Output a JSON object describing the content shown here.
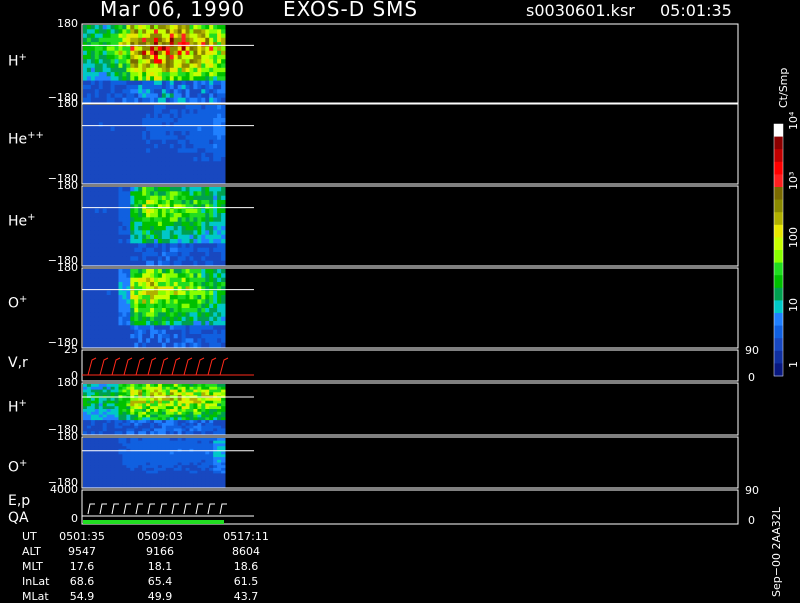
{
  "header": {
    "date": "Mar 06, 1990",
    "instrument": "EXOS-D SMS",
    "file": "s0030601.ksr",
    "time": "05:01:35"
  },
  "colors": {
    "background": "#000000",
    "frame": "#ffffff",
    "velocity_trace": "#ff2a1a",
    "qa_bar": "#22dd22"
  },
  "panels": [
    {
      "id": "h-plus",
      "label": "H",
      "sup": "+",
      "top": "180",
      "bottom": "−180"
    },
    {
      "id": "he-plus-plus",
      "label": "He",
      "sup": "++",
      "top": "180",
      "bottom": "−180"
    },
    {
      "id": "he-plus",
      "label": "He",
      "sup": "+",
      "top": "180",
      "bottom": "−180"
    },
    {
      "id": "o-plus",
      "label": "O",
      "sup": "+",
      "top": "180",
      "bottom": "−180"
    },
    {
      "id": "v-r",
      "label": "V,r",
      "sup": "",
      "top": "25",
      "bottom": "0",
      "right_top": "90",
      "right_bottom": "0"
    },
    {
      "id": "h-plus-2",
      "label": "H",
      "sup": "+",
      "top": "180",
      "bottom": "−180"
    },
    {
      "id": "o-plus-2",
      "label": "O",
      "sup": "+",
      "top": "180",
      "bottom": "−180"
    },
    {
      "id": "e-p",
      "label": "E,p",
      "sup": "",
      "top": "4000",
      "bottom": "0",
      "right_top": "90",
      "right_bottom": "0"
    }
  ],
  "qa_label": "QA",
  "colorbar": {
    "unit": "Ct/Smp",
    "labels": [
      "10⁴",
      "10³",
      "100",
      "10",
      "1"
    ],
    "stops": [
      "#ffffff",
      "#8b0000",
      "#c00000",
      "#ff0000",
      "#ff2020",
      "#7a6a00",
      "#8a8a00",
      "#b0b000",
      "#e8e800",
      "#c8ff00",
      "#88ff00",
      "#20dd20",
      "#00c000",
      "#00a050",
      "#00c8c8",
      "#2080ff",
      "#1060e0",
      "#1848c0",
      "#1030a0",
      "#081880"
    ]
  },
  "side_label": "Sep−00  2AA32L",
  "footer": {
    "rows": [
      {
        "name": "UT",
        "values": [
          "0501:35",
          "0509:03",
          "0517:11"
        ]
      },
      {
        "name": "ALT",
        "values": [
          "9547",
          "9166",
          "8604"
        ]
      },
      {
        "name": "MLT",
        "values": [
          "17.6",
          "18.1",
          "18.6"
        ]
      },
      {
        "name": "InLat",
        "values": [
          "68.6",
          "65.4",
          "61.5"
        ]
      },
      {
        "name": "MLat",
        "values": [
          "54.9",
          "49.9",
          "43.7"
        ]
      }
    ]
  },
  "chart_data": {
    "type": "heatmap",
    "x_ticks": [
      "0501:35",
      "0509:03",
      "0517:11"
    ],
    "y_range_pitch": [
      -180,
      180
    ],
    "colorbar_range": [
      1,
      10000
    ],
    "colorbar_scale": "log",
    "panels": [
      {
        "name": "H+",
        "activity": [
          0.35,
          0.35,
          0.4,
          0.55,
          0.8,
          0.85,
          0.9,
          0.85,
          0.8,
          0.75,
          0.7,
          0.6
        ]
      },
      {
        "name": "He++",
        "activity": [
          0.05,
          0.05,
          0.05,
          0.05,
          0.05,
          0.08,
          0.08,
          0.08,
          0.08,
          0.1,
          0.1,
          0.15
        ]
      },
      {
        "name": "He+",
        "activity": [
          0.05,
          0.05,
          0.05,
          0.1,
          0.35,
          0.5,
          0.45,
          0.45,
          0.4,
          0.4,
          0.35,
          0.3
        ]
      },
      {
        "name": "O+",
        "activity": [
          0.05,
          0.05,
          0.05,
          0.2,
          0.55,
          0.6,
          0.55,
          0.5,
          0.5,
          0.45,
          0.4,
          0.35
        ]
      },
      {
        "name": "H+ (2)",
        "activity": [
          0.3,
          0.3,
          0.3,
          0.45,
          0.6,
          0.6,
          0.6,
          0.6,
          0.6,
          0.55,
          0.55,
          0.5
        ]
      },
      {
        "name": "O+ (2)",
        "activity": [
          0.05,
          0.05,
          0.05,
          0.08,
          0.1,
          0.1,
          0.1,
          0.1,
          0.1,
          0.1,
          0.1,
          0.2
        ]
      }
    ]
  }
}
